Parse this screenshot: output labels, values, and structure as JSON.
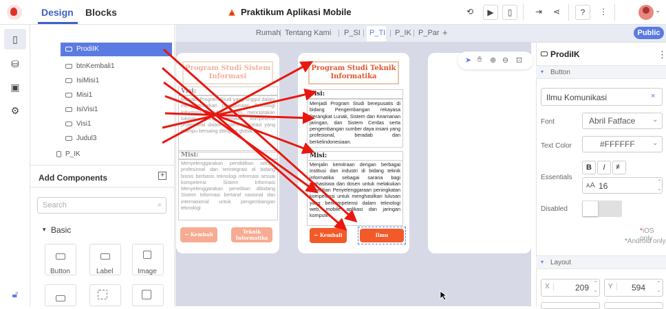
{
  "header": {
    "tabs": [
      "Design",
      "Blocks"
    ],
    "project_title": "Praktikum Aplikasi Mobile",
    "toolbar_icons": [
      "history-icon",
      "preview-icon",
      "device-icon",
      "export-icon",
      "share-icon",
      "help-icon",
      "more-icon"
    ],
    "accent": "#3d5fc9"
  },
  "pages": {
    "tabs": [
      "Rumah",
      "Tentang Kami",
      "P_SI",
      "P_TI",
      "P_IK",
      "P_Par"
    ],
    "add": "+",
    "selected": "P_TI",
    "public_label": "Public"
  },
  "tree": {
    "items": [
      {
        "label": "ProdiIK",
        "selected": true
      },
      {
        "label": "btnKembali1"
      },
      {
        "label": "IsiMisi1"
      },
      {
        "label": "Misi1"
      },
      {
        "label": "IsiVisi1"
      },
      {
        "label": "Visi1"
      },
      {
        "label": "Judul3"
      },
      {
        "label": "P_IK"
      }
    ]
  },
  "components": {
    "title": "Add Components",
    "search_placeholder": "Search",
    "section": "Basic",
    "items": [
      "Button",
      "Label",
      "Image"
    ]
  },
  "screen_si": {
    "title": "Program Studi Sistem Informasi",
    "visi_h": "Visi:",
    "visi_b": "Menjadi Program Studi yang unggul dalam mengoptimalkan penggunaan Teknologi Informasi di bidang bisnis, menciptakan lulusan yang memiliki kompetensi profesional dalam Sistem Informasi yang mampu bersaing ditingkat global.",
    "misi_h": "Misi:",
    "misi_b": "Menyelenggarakan pendidikan secara profesional dan terintegrasi di bidang bisnis berbasis teknologi informasi sesuai kompetensi Sistem Informasi Menyelenggarakan penelitian dibidang Sistem Informasi bertaraf nasional dan internasional untuk pengembangan teknologi",
    "btn_back": "← Kembali",
    "btn_next": "Teknik Informatika"
  },
  "screen_ti": {
    "title": "Program Studi Teknik Informatika",
    "visi_h": "Visi:",
    "visi_b": "Menjadi Program Studi berepusatis di bidang Pengembangan rekayasa Perangkat Lunak, Sistem dan Keamanan jaringan, dan Sistem Cerdas serta pengembangan sumber daya insani yang profesional, beradab dan berkelindonesiaan.",
    "misi_h": "Misi:",
    "misi_b": "Menjalin kemitraan dengan berbagai institusi dan industri di bidang teknik informatika sebagai sarana bagi mahasiswa dan dosen untuk melakukan penelitian Penyelenggaraan peningkatan kompetensi untuk menghasilkan lulusan yang berkompetensi dalam teknologi web, mobile aplikasi dan jaringan komputer",
    "btn_back": "← Kembali",
    "btn_next": "Ilmu Komunikasi"
  },
  "inspector": {
    "component": "ProdiIK",
    "section_button": "Button",
    "text_value": "Ilmu Komunikasi",
    "font_label": "Font",
    "font_value": "Abril Fatface",
    "text_color_label": "Text Color",
    "text_color_value": "#FFFFFF",
    "essentials_label": "Essentials",
    "font_size": "16",
    "disabled_label": "Disabled",
    "ios_only": "iOS only",
    "android_only": "Android only",
    "section_layout": "Layout",
    "x_label": "X",
    "x_value": "209",
    "y_label": "Y",
    "y_value": "594"
  },
  "colors": {
    "arrow_red": "#e8170f",
    "button_orange": "#f25a2a",
    "selection_blue": "#5b7be2"
  }
}
